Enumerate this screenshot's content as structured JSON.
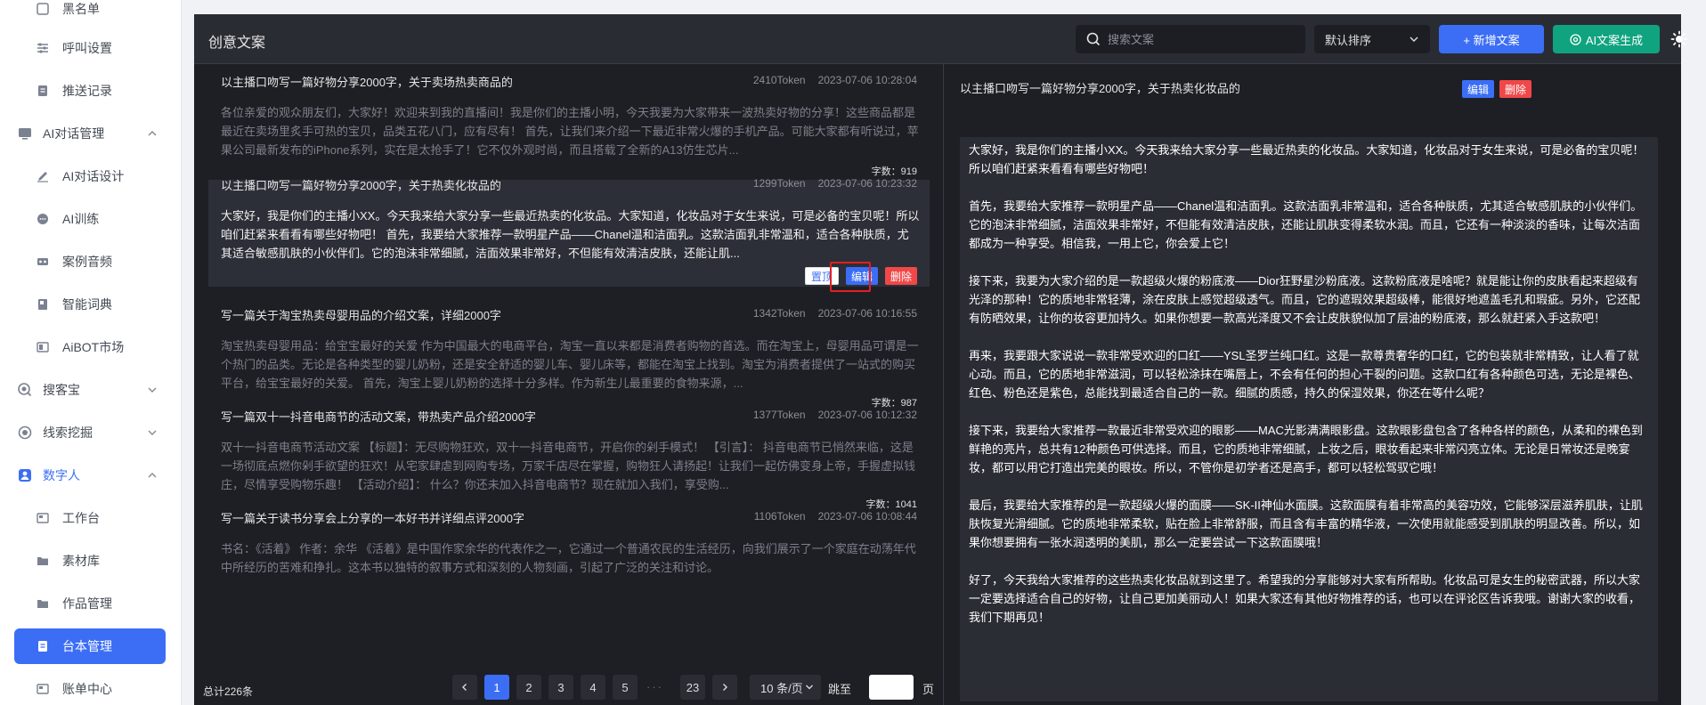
{
  "sidebar": {
    "items": [
      {
        "label": "黑名单",
        "type": "sub",
        "icon": "list-icon"
      },
      {
        "label": "呼叫设置",
        "type": "sub",
        "icon": "sliders-icon"
      },
      {
        "label": "推送记录",
        "type": "sub",
        "icon": "document-icon"
      },
      {
        "label": "AI对话管理",
        "type": "group",
        "icon": "monitor-icon",
        "expanded": true
      },
      {
        "label": "AI对话设计",
        "type": "sub",
        "icon": "pen-icon"
      },
      {
        "label": "AI训练",
        "type": "sub",
        "icon": "chat-icon"
      },
      {
        "label": "案例音频",
        "type": "sub",
        "icon": "cassette-icon"
      },
      {
        "label": "智能词典",
        "type": "sub",
        "icon": "book-icon"
      },
      {
        "label": "AiBOT市场",
        "type": "sub",
        "icon": "robot-icon"
      },
      {
        "label": "搜客宝",
        "type": "group",
        "icon": "search-circle-icon",
        "expanded": false
      },
      {
        "label": "线索挖掘",
        "type": "group",
        "icon": "target-icon",
        "expanded": false
      },
      {
        "label": "数字人",
        "type": "group",
        "icon": "person-icon",
        "expanded": true
      },
      {
        "label": "工作台",
        "type": "sub",
        "icon": "workbench-icon"
      },
      {
        "label": "素材库",
        "type": "sub",
        "icon": "folder-icon"
      },
      {
        "label": "作品管理",
        "type": "sub",
        "icon": "folder-icon"
      },
      {
        "label": "台本管理",
        "type": "sub",
        "icon": "script-icon",
        "active": true
      },
      {
        "label": "账单中心",
        "type": "sub",
        "icon": "bill-icon"
      }
    ]
  },
  "header": {
    "title": "创意文案",
    "search_placeholder": "搜索文案",
    "sort_label": "默认排序",
    "new_button": "+ 新增文案",
    "ai_button": "AI文案生成"
  },
  "actions": {
    "pin": "置顶",
    "edit": "编辑",
    "delete": "删除"
  },
  "list": [
    {
      "title": "以主播口吻写一篇好物分享2000字，关于卖场热卖商品的",
      "tokens": "2410Token",
      "date": "2023-07-06 10:28:04",
      "body": "各位亲爱的观众朋友们，大家好！欢迎来到我的直播间！我是你们的主播小明，今天我要为大家带来一波热卖好物的分享！这些商品都是最近在卖场里炙手可热的宝贝，品类五花八门，应有尽有！ 首先，让我们来介绍一下最近非常火爆的手机产品。可能大家都有听说过，苹果公司最新发布的iPhone系列，实在是太抢手了！它不仅外观时尚，而且搭载了全新的A13仿生芯片...",
      "count": "字数：919"
    },
    {
      "title": "以主播口吻写一篇好物分享2000字，关于热卖化妆品的",
      "tokens": "1299Token",
      "date": "2023-07-06 10:23:32",
      "body": "大家好，我是你们的主播小XX。今天我来给大家分享一些最近热卖的化妆品。大家知道，化妆品对于女生来说，可是必备的宝贝呢！所以咱们赶紧来看看有哪些好物吧！ 首先，我要给大家推荐一款明星产品——Chanel温和洁面乳。这款洁面乳非常温和，适合各种肤质，尤其适合敏感肌肤的小伙伴们。它的泡沫非常细腻，洁面效果非常好，不但能有效清洁皮肤，还能让肌...",
      "selected": true
    },
    {
      "title": "写一篇关于淘宝热卖母婴用品的介绍文案，详细2000字",
      "tokens": "1342Token",
      "date": "2023-07-06 10:16:55",
      "body": "淘宝热卖母婴用品：给宝宝最好的关爱 作为中国最大的电商平台，淘宝一直以来都是消费者购物的首选。而在淘宝上，母婴用品可谓是一个热门的品类。无论是各种类型的婴儿奶粉，还是安全舒适的婴儿车、婴儿床等，都能在淘宝上找到。淘宝为消费者提供了一站式的购买平台，给宝宝最好的关爱。 首先，淘宝上婴儿奶粉的选择十分多样。作为新生儿最重要的食物来源，...",
      "count": "字数：987"
    },
    {
      "title": "写一篇双十一抖音电商节的活动文案，带热卖产品介绍2000字",
      "tokens": "1377Token",
      "date": "2023-07-06 10:12:32",
      "body": "双十一抖音电商节活动文案 【标题】：无尽购物狂欢，双十一抖音电商节，开启你的剁手模式！ 【引言】： 抖音电商节已悄然来临，这是一场彻底点燃你剁手欲望的狂欢！从宅家肆虐到网购专场，万家千店尽在掌握，购物狂人请扬起！让我们一起仿佛变身上帝，手握虚拟钱庄，尽情享受购物乐趣！ 【活动介绍】： 什么？你还未加入抖音电商节？现在就加入我们，享受购...",
      "count": "字数：1041"
    },
    {
      "title": "写一篇关于读书分享会上分享的一本好书并详细点评2000字",
      "tokens": "1106Token",
      "date": "2023-07-06 10:08:44",
      "body": "书名：《活着》 作者：余华 《活着》是中国作家余华的代表作之一，它通过一个普通农民的生活经历，向我们展示了一个家庭在动荡年代中所经历的苦难和挣扎。这本书以独特的叙事方式和深刻的人物刻画，引起了广泛的关注和讨论。"
    }
  ],
  "pagination": {
    "total": "总计226条",
    "pages": [
      "1",
      "2",
      "3",
      "4",
      "5"
    ],
    "dots": "···",
    "last": "23",
    "page_size": "10 条/页",
    "goto_label": "跳至",
    "page_label": "页"
  },
  "detail": {
    "title": "以主播口吻写一篇好物分享2000字，关于热卖化妆品的",
    "paragraphs": [
      "大家好，我是你们的主播小XX。今天我来给大家分享一些最近热卖的化妆品。大家知道，化妆品对于女生来说，可是必备的宝贝呢！所以咱们赶紧来看看有哪些好物吧！",
      "首先，我要给大家推荐一款明星产品——Chanel温和洁面乳。这款洁面乳非常温和，适合各种肤质，尤其适合敏感肌肤的小伙伴们。它的泡沫非常细腻，洁面效果非常好，不但能有效清洁皮肤，还能让肌肤变得柔软水润。而且，它还有一种淡淡的香味，让每次洁面都成为一种享受。相信我，一用上它，你会爱上它！",
      "接下来，我要为大家介绍的是一款超级火爆的粉底液——Dior狂野星沙粉底液。这款粉底液是啥呢？就是能让你的皮肤看起来超级有光泽的那种！它的质地非常轻薄，涂在皮肤上感觉超级透气。而且，它的遮瑕效果超级棒，能很好地遮盖毛孔和瑕疵。另外，它还配有防晒效果，让你的妆容更加持久。如果你想要一款高光泽度又不会让皮肤貌似加了层油的粉底液，那么就赶紧入手这款吧！",
      "再来，我要跟大家说说一款非常受欢迎的口红——YSL圣罗兰纯口红。这是一款尊贵奢华的口红，它的包装就非常精致，让人看了就心动。而且，它的质地非常滋润，可以轻松涂抹在嘴唇上，不会有任何的担心干裂的问题。这款口红有各种颜色可选，无论是裸色、红色、粉色还是紫色，总能找到最适合自己的一款。细腻的质感，持久的保湿效果，你还在等什么呢？",
      "接下来，我要给大家推荐一款最近非常受欢迎的眼影——MAC光影满满眼影盘。这款眼影盘包含了各种各样的颜色，从柔和的裸色到鲜艳的亮片，总共有12种颜色可供选择。而且，它的质地非常细腻，上妆之后，眼妆看起来非常闪亮立体。无论是日常妆还是晚宴妆，都可以用它打造出完美的眼妆。所以，不管你是初学者还是高手，都可以轻松驾驭它哦！",
      "最后，我要给大家推荐的是一款超级火爆的面膜——SK-II神仙水面膜。这款面膜有着非常高的美容功效，它能够深层滋养肌肤，让肌肤恢复光滑细腻。它的质地非常柔软，贴在脸上非常舒服，而且含有丰富的精华液，一次使用就能感受到肌肤的明显改善。所以，如果你想要拥有一张水润透明的美肌，那么一定要尝试一下这款面膜哦！",
      "好了，今天我给大家推荐的这些热卖化妆品就到这里了。希望我的分享能够对大家有所帮助。化妆品可是女生的秘密武器，所以大家一定要选择适合自己的好物，让自己更加美丽动人！如果大家还有其他好物推荐的话，也可以在评论区告诉我哦。谢谢大家的收看，我们下期再见！"
    ]
  },
  "colors": {
    "accent": "#3c6ef5",
    "ai_button": "#10a37f",
    "delete": "#f04848",
    "panel_bg": "#1e1f25",
    "highlight_box": "#e02020"
  }
}
